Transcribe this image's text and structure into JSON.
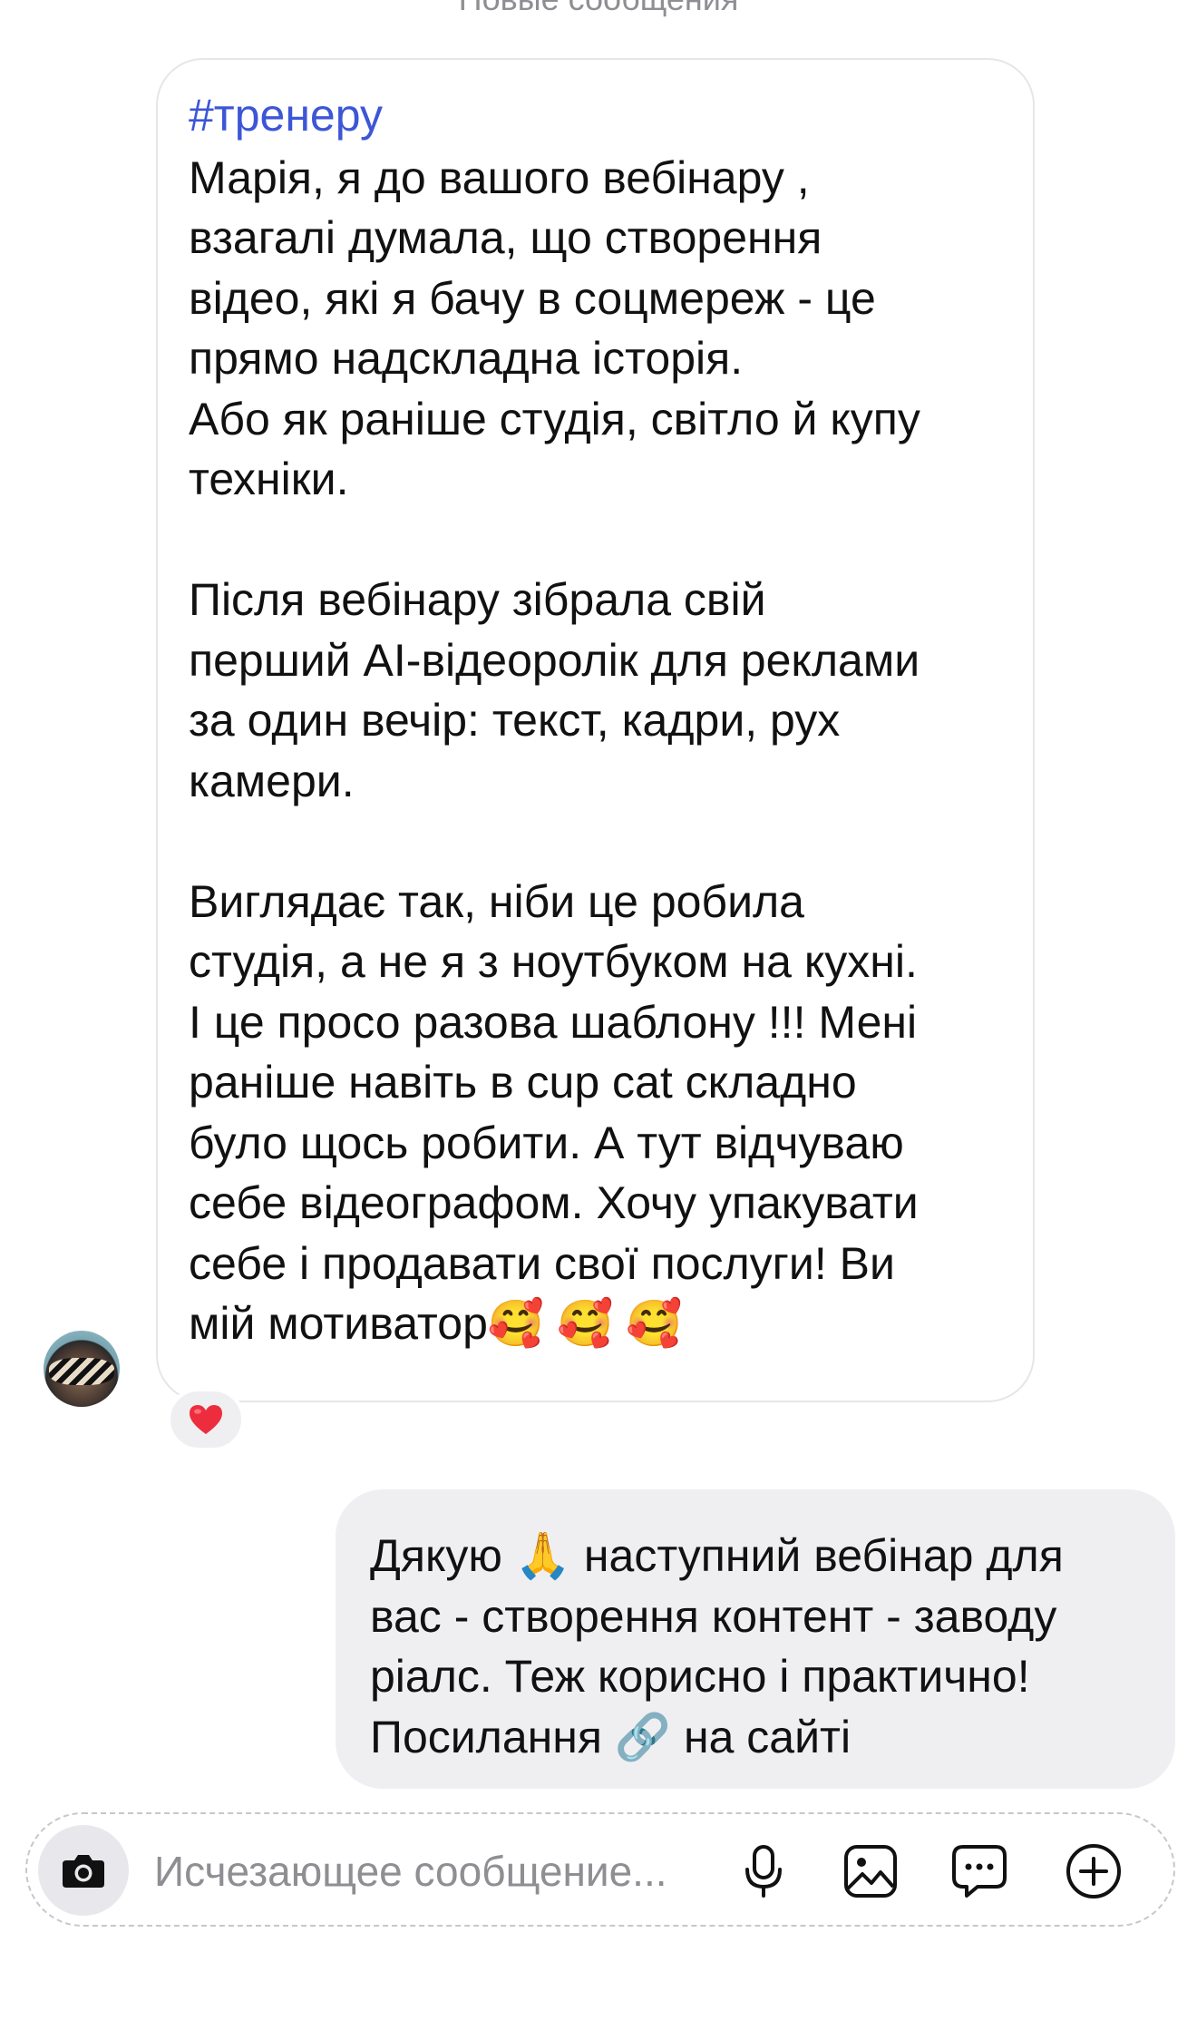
{
  "divider": {
    "label": "Новые сообщения"
  },
  "incoming_message": {
    "tag": "#тренеру",
    "text": "Марія, я до вашого вебінару ,\nвзагалі думала, що створення\nвідео, які я бачу в соцмереж - це\nпрямо надскладна історія.\nАбо як раніше студія, світло й купу\nтехніки.\n\nПісля вебінару зібрала свій\nперший AI-відеоролік для реклами\nза один вечір: текст, кадри, рух\nкамери.\n\nВиглядає так, ніби це робила\nстудія, а не я з ноутбуком на кухні.\nІ це просо разова шаблону !!! Мені\nраніше навіть в cup cat складно\nбуло щось робити. А тут відчуваю\nсебе відеографом. Хочу упакувати\nсебе і продавати свої послуги! Ви\nмій мотиватор🥰 🥰 🥰",
    "reaction": "❤️"
  },
  "outgoing_message": {
    "text": "Дякую 🙏 наступний вебінар для\nвас - створення контент - заводу\nріалс. Теж корисно і практично!\nПосилання 🔗 на сайті"
  },
  "composer": {
    "placeholder": "Исчезающее сообщение..."
  },
  "icons": {
    "camera": "camera-icon",
    "mic": "microphone-icon",
    "gallery": "gallery-icon",
    "sticker": "sticker-icon",
    "plus": "plus-icon"
  }
}
